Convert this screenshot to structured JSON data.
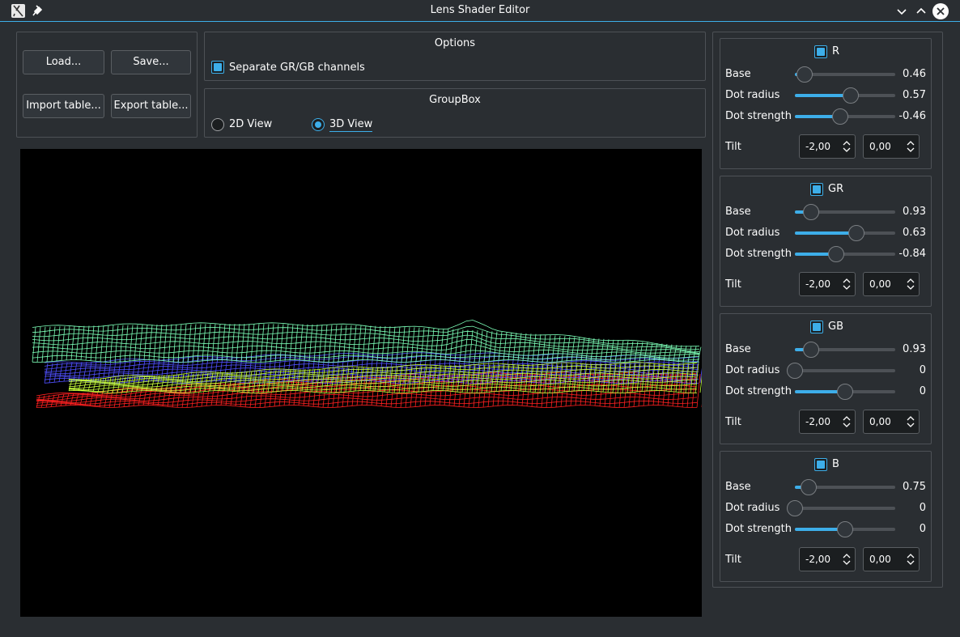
{
  "window": {
    "title": "Lens Shader Editor"
  },
  "file_buttons": {
    "load": "Load...",
    "save": "Save...",
    "import": "Import table...",
    "export": "Export table..."
  },
  "options": {
    "title": "Options",
    "separate_label": "Separate GR/GB channels",
    "separate_checked": true
  },
  "view_group": {
    "title": "GroupBox",
    "view_2d": "2D View",
    "view_3d": "3D View",
    "selected": "3D View"
  },
  "surface_colors": {
    "green_cyan": "#7dffb8",
    "yellow_green": "#c8ff3c",
    "blue": "#5050ff",
    "red": "#ff2020"
  },
  "channels": [
    {
      "name": "R",
      "checked": true,
      "base": {
        "label": "Base",
        "value": "0.46",
        "level": 0.1
      },
      "dot_radius": {
        "label": "Dot radius",
        "value": "0.57",
        "level": 0.56
      },
      "dot_strength": {
        "label": "Dot strength",
        "value": "-0.46",
        "level": 0.45
      },
      "tilt": {
        "label": "Tilt",
        "x": "-2,00",
        "y": "0,00"
      }
    },
    {
      "name": "GR",
      "checked": true,
      "base": {
        "label": "Base",
        "value": "0.93",
        "level": 0.16
      },
      "dot_radius": {
        "label": "Dot radius",
        "value": "0.63",
        "level": 0.61
      },
      "dot_strength": {
        "label": "Dot strength",
        "value": "-0.84",
        "level": 0.41
      },
      "tilt": {
        "label": "Tilt",
        "x": "-2,00",
        "y": "0,00"
      }
    },
    {
      "name": "GB",
      "checked": true,
      "base": {
        "label": "Base",
        "value": "0.93",
        "level": 0.16
      },
      "dot_radius": {
        "label": "Dot radius",
        "value": "0",
        "level": 0.0
      },
      "dot_strength": {
        "label": "Dot strength",
        "value": "0",
        "level": 0.5
      },
      "tilt": {
        "label": "Tilt",
        "x": "-2,00",
        "y": "0,00"
      }
    },
    {
      "name": "B",
      "checked": true,
      "base": {
        "label": "Base",
        "value": "0.75",
        "level": 0.14
      },
      "dot_radius": {
        "label": "Dot radius",
        "value": "0",
        "level": 0.0
      },
      "dot_strength": {
        "label": "Dot strength",
        "value": "0",
        "level": 0.5
      },
      "tilt": {
        "label": "Tilt",
        "x": "-2,00",
        "y": "0,00"
      }
    }
  ]
}
